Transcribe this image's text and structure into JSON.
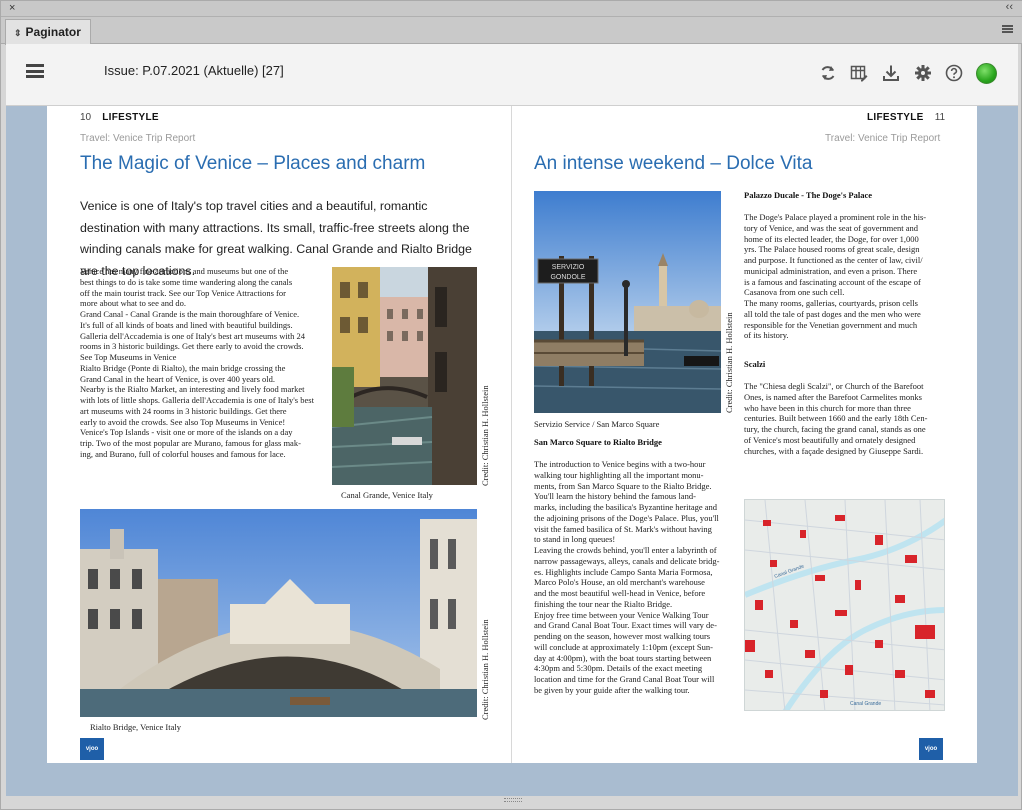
{
  "window": {
    "close": "×",
    "collapse": "‹‹"
  },
  "panel": {
    "tab_label": "Paginator",
    "tab_icon": "⇕"
  },
  "toolbar": {
    "issue": "Issue: P.07.2021 (Aktuelle) [27]",
    "icons": [
      "menu-icon",
      "refresh-icon",
      "layout-edit-icon",
      "download-icon",
      "gear-icon",
      "help-icon",
      "status-indicator"
    ],
    "status_color": "#2aa61e"
  },
  "left_page": {
    "page_number": "10",
    "section": "LIFESTYLE",
    "kicker": "Travel: Venice Trip Report",
    "headline": "The Magic of Venice – Places and charm",
    "lead": "Venice is one of Italy's top travel cities and a beautiful, romantic destination with many attractions. Its small, traffic-free streets along the winding canals make for great walking. Canal Grande and Rialto Bridge are the top locations.",
    "body": "Venice has many fine attractions and museums but one of the\nbest things to do is take some time wandering along the canals\noff the main tourist track. See our Top Venice Attractions for\nmore about what to see and do.\nGrand Canal - Canal Grande is the main thoroughfare of Venice.\nIt's full of all kinds of boats and lined with beautiful buildings.\nGalleria dell'Accademia is one of Italy's best art museums with 24\nrooms in 3 historic buildings. Get there early to avoid the crowds.\nSee Top Museums in Venice\nRialto Bridge (Ponte di Rialto), the main bridge crossing the\nGrand Canal in the heart of Venice, is over 400 years old.\nNearby is the Rialto Market, an interesting and lively food market\nwith lots of little shops. Galleria dell'Accademia is one of Italy's best\nart museums with 24 rooms in 3 historic buildings. Get there\nearly to avoid the crowds. See also Top Museums in Venice!\nVenice's Top Islands - visit one or more of the islands on a day\ntrip. Two of the most popular are Murano, famous for glass mak-\ning, and Burano, full of colorful houses and famous for lace.",
    "photo1_credit": "Credit: Christian H. Hollstein",
    "photo1_caption": "Canal Grande, Venice Italy",
    "photo2_credit": "Credit: Christian H. Hollstein",
    "photo2_caption": "Rialto Bridge, Venice Italy",
    "logo": "vjoo"
  },
  "right_page": {
    "page_number": "11",
    "section": "LIFESTYLE",
    "kicker": "Travel: Venice Trip Report",
    "headline": "An intense weekend – Dolce Vita",
    "photo_credit": "Credit: Christian H. Hollstein",
    "photo_sign": "SERVIZIO\nGONDOLE",
    "photo_caption": "Servizio Service / San Marco Square",
    "subhead1": "San Marco Square to Rialto Bridge",
    "body1": "The introduction to Venice begins with a two-hour\nwalking tour highlighting all the important monu-\nments, from San Marco Square to the Rialto Bridge.\nYou'll learn the history behind the famous land-\nmarks, including the basilica's Byzantine heritage and\nthe adjoining prisons of the Doge's Palace. Plus, you'll\nvisit the famed basilica of St. Mark's without having\nto stand in long queues!\nLeaving the crowds behind, you'll enter a labyrinth of\nnarrow passageways, alleys, canals and delicate bridg-\nes. Highlights include Campo Santa Maria Formosa,\nMarco Polo's House, an old merchant's warehouse\nand the most beautiful well-head in Venice, before\nfinishing the tour near the Rialto Bridge.\nEnjoy free time between your Venice Walking Tour\nand Grand Canal Boat Tour. Exact times will vary de-\npending on the season, however most walking tours\nwill conclude at approximately 1:10pm (except Sun-\nday at 4:00pm), with the boat tours starting between\n4:30pm and 5:30pm. Details of the exact meeting\nlocation and time for the Grand Canal Boat Tour will\nbe given by your guide after the walking tour.",
    "subhead2": "Palazzo Ducale - The Doge's Palace",
    "body2": "The Doge's Palace played a prominent role in the his-\ntory of Venice, and was the seat of government and\nhome of its elected leader, the Doge, for over 1,000\nyrs. The Palace housed rooms of great scale, design\nand purpose. It functioned as the center of law, civil/\nmunicipal administration, and even a prison. There\nis a famous and fascinating account of the escape of\nCasanova from one such cell.\nThe many rooms, gallerias, courtyards, prison cells\nall told the tale of past doges and the men who were\nresponsible for the Venetian government and much\nof its history.",
    "subhead3": "Scalzi",
    "body3": "The \"Chiesa degli Scalzi\", or Church of the Barefoot\nOnes, is named after the Barefoot Carmelites monks\nwho have been in this church for more than three\ncenturies. Built between 1660 and the early 18th Cen-\ntury, the church, facing the grand canal, stands as one\nof Venice's most beautifully and ornately designed\nchurches, with a façade designed by Giuseppe Sardi.",
    "map_label1": "Canal Grande",
    "map_label2": "Canal Grande",
    "logo": "vjoo"
  }
}
